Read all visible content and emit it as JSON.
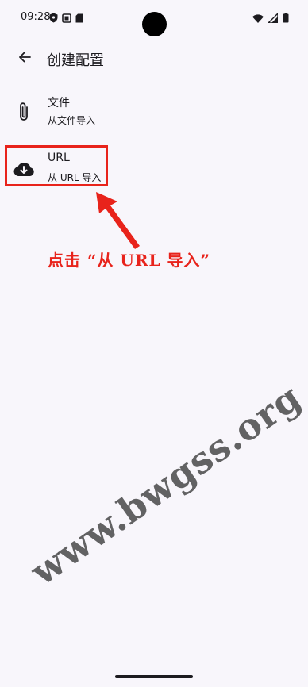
{
  "status_bar": {
    "time": "09:28",
    "icons_left": [
      "shield-icon",
      "screenshot-icon",
      "sd-card-icon"
    ],
    "icons_right": [
      "wifi-icon",
      "signal-icon",
      "battery-icon"
    ]
  },
  "app_bar": {
    "title": "创建配置",
    "back_icon": "arrow-back-icon"
  },
  "options": [
    {
      "id": "file",
      "icon": "paperclip-icon",
      "title": "文件",
      "subtitle": "从文件导入"
    },
    {
      "id": "url",
      "icon": "cloud-download-icon",
      "title": "URL",
      "subtitle": "从 URL 导入"
    }
  ],
  "annotation": {
    "text": "点击 “从 URL 导入”",
    "color": "#e8231b"
  },
  "watermark": "www.bwgss.org",
  "colors": {
    "background": "#f8f6fb",
    "text": "#1c1b1f",
    "accent_red": "#e8231b"
  }
}
